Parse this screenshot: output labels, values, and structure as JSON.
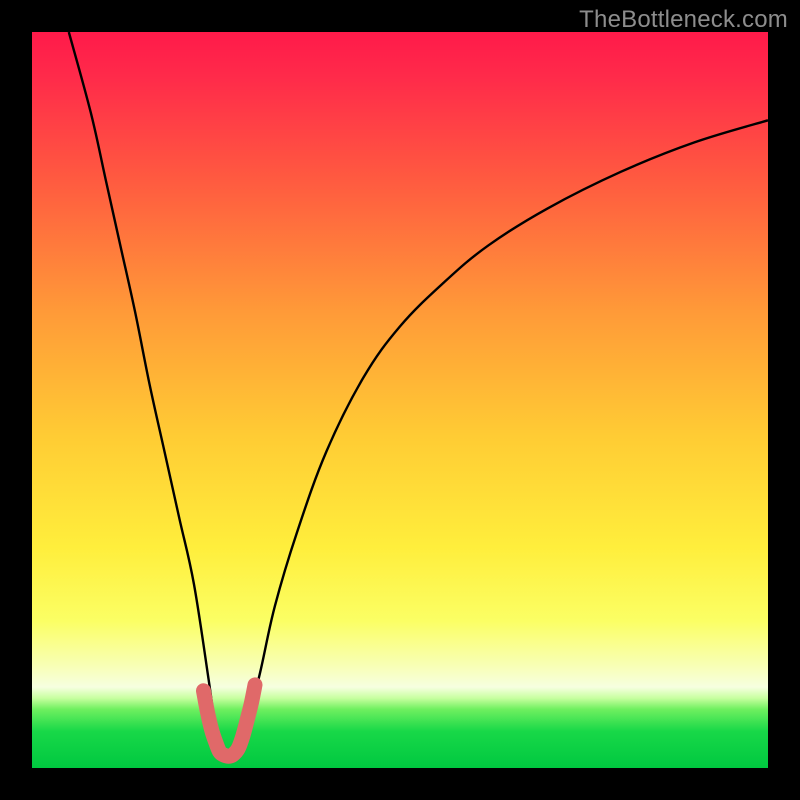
{
  "watermark": "TheBottleneck.com",
  "chart_data": {
    "type": "line",
    "title": "",
    "xlabel": "",
    "ylabel": "",
    "xlim": [
      0,
      100
    ],
    "ylim": [
      0,
      100
    ],
    "background_gradient_colors": [
      "#ff1a47",
      "#ff6a3a",
      "#ffb63a",
      "#ffe83a",
      "#fcff9a",
      "#7fff3a",
      "#00d04a"
    ],
    "series": [
      {
        "name": "bottleneck-curve",
        "x": [
          5,
          8,
          10,
          12,
          14,
          16,
          18,
          20,
          22,
          24,
          25,
          26,
          27,
          28,
          29,
          31,
          33,
          36,
          40,
          45,
          50,
          56,
          62,
          70,
          80,
          90,
          100
        ],
        "y": [
          100,
          89,
          80,
          71,
          62,
          52,
          43,
          34,
          25,
          12,
          5,
          2,
          1.6,
          2,
          5,
          13,
          22,
          32,
          43,
          53,
          60,
          66,
          71,
          76,
          81,
          85,
          88
        ],
        "color": "#000000"
      },
      {
        "name": "optimal-zone-marker",
        "x": [
          23.3,
          23.8,
          24.4,
          25.0,
          25.5,
          26.0,
          26.7,
          27.3,
          28.0,
          28.6,
          29.2,
          29.8,
          30.3
        ],
        "y": [
          10.5,
          7.8,
          5.2,
          3.4,
          2.2,
          1.8,
          1.6,
          1.8,
          2.6,
          4.2,
          6.4,
          8.8,
          11.3
        ],
        "color": "#e06969"
      }
    ],
    "optimal_x": 27
  }
}
